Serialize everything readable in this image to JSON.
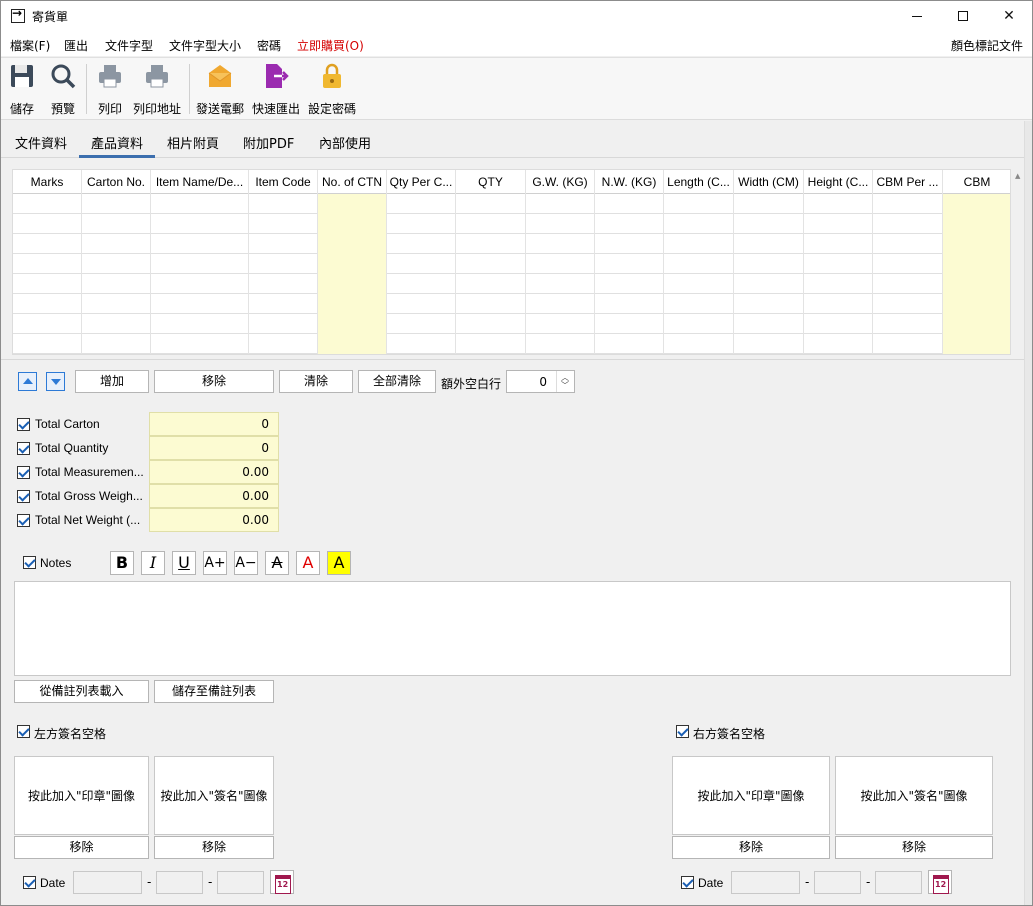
{
  "window": {
    "title": "寄貨單"
  },
  "menu": {
    "file": "檔案(F)",
    "export": "匯出",
    "font": "文件字型",
    "font_size": "文件字型大小",
    "password": "密碼",
    "buy": "立即購買(O)",
    "color_doc": "顏色標記文件"
  },
  "toolbar": {
    "save": "儲存",
    "preview": "預覽",
    "print": "列印",
    "print_address": "列印地址",
    "send_email": "發送電郵",
    "quick_export": "快速匯出",
    "set_password": "設定密碼"
  },
  "tabs": [
    "文件資料",
    "產品資料",
    "相片附頁",
    "附加PDF",
    "內部使用"
  ],
  "grid": {
    "columns": [
      "Marks",
      "Carton No.",
      "Item Name/De...",
      "Item Code",
      "No. of CTN",
      "Qty Per C...",
      "QTY",
      "G.W. (KG)",
      "N.W. (KG)",
      "Length (C...",
      "Width (CM)",
      "Height (C...",
      "CBM Per ...",
      "CBM"
    ],
    "highlight_columns": [
      4,
      13
    ],
    "row_count": 8
  },
  "row_controls": {
    "add": "增加",
    "remove": "移除",
    "clear": "清除",
    "clear_all": "全部清除",
    "extra_blank_label": "額外空白行",
    "extra_blank_value": "0"
  },
  "totals": [
    {
      "label": "Total Carton",
      "value": "0"
    },
    {
      "label": "Total Quantity",
      "value": "0"
    },
    {
      "label": "Total Measuremen...",
      "value": "0.00"
    },
    {
      "label": "Total Gross Weigh...",
      "value": "0.00"
    },
    {
      "label": "Total Net Weight (...",
      "value": "0.00"
    }
  ],
  "notes": {
    "label": "Notes",
    "load_button": "從備註列表載入",
    "save_button": "儲存至備註列表",
    "format": {
      "bold": "B",
      "italic": "I",
      "underline": "U",
      "grow": "A+",
      "shrink": "A−",
      "strike": "A",
      "color": "A",
      "highlight": "A"
    }
  },
  "signature_left": {
    "label": "左方簽名空格",
    "stamp": "按此加入\"印章\"圖像",
    "sign": "按此加入\"簽名\"圖像",
    "remove": "移除",
    "date_label": "Date"
  },
  "signature_right": {
    "label": "右方簽名空格",
    "stamp": "按此加入\"印章\"圖像",
    "sign": "按此加入\"簽名\"圖像",
    "remove": "移除",
    "date_label": "Date"
  },
  "date_separator": "-",
  "colors": {
    "accent": "#3c6fae",
    "highlight_cell": "#fcfbd2",
    "buy_menu": "#d40000"
  }
}
